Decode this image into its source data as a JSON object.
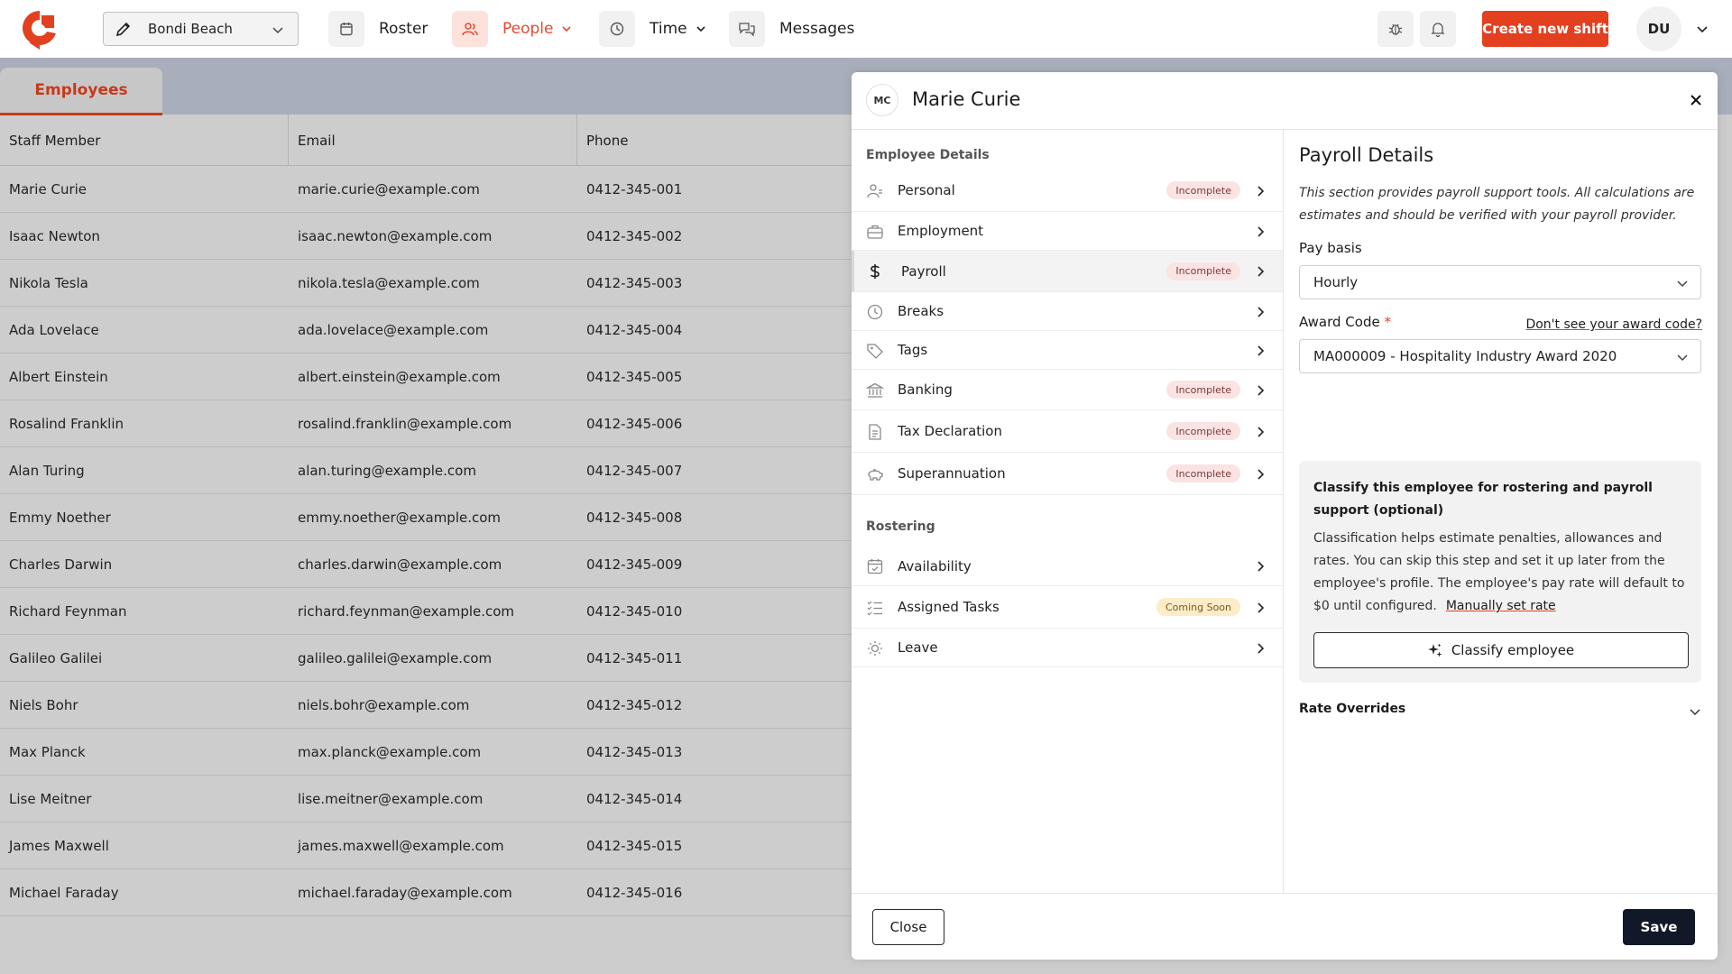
{
  "topbar": {
    "location": "Bondi Beach",
    "nav": [
      {
        "label": "Roster",
        "icon": "calendar-icon"
      },
      {
        "label": "People",
        "icon": "people-icon",
        "active": true
      },
      {
        "label": "Time",
        "icon": "clock-icon"
      },
      {
        "label": "Messages",
        "icon": "messages-icon"
      }
    ],
    "create_shift": "Create new shift",
    "user_initials": "DU",
    "accent_color": "#e2401f"
  },
  "tabs": {
    "employees": "Employees"
  },
  "table": {
    "headers": [
      "Staff Member",
      "Email",
      "Phone"
    ],
    "rows": [
      [
        "Marie Curie",
        "marie.curie@example.com",
        "0412-345-001"
      ],
      [
        "Isaac Newton",
        "isaac.newton@example.com",
        "0412-345-002"
      ],
      [
        "Nikola Tesla",
        "nikola.tesla@example.com",
        "0412-345-003"
      ],
      [
        "Ada Lovelace",
        "ada.lovelace@example.com",
        "0412-345-004"
      ],
      [
        "Albert Einstein",
        "albert.einstein@example.com",
        "0412-345-005"
      ],
      [
        "Rosalind Franklin",
        "rosalind.franklin@example.com",
        "0412-345-006"
      ],
      [
        "Alan Turing",
        "alan.turing@example.com",
        "0412-345-007"
      ],
      [
        "Emmy Noether",
        "emmy.noether@example.com",
        "0412-345-008"
      ],
      [
        "Charles Darwin",
        "charles.darwin@example.com",
        "0412-345-009"
      ],
      [
        "Richard Feynman",
        "richard.feynman@example.com",
        "0412-345-010"
      ],
      [
        "Galileo Galilei",
        "galileo.galilei@example.com",
        "0412-345-011"
      ],
      [
        "Niels Bohr",
        "niels.bohr@example.com",
        "0412-345-012"
      ],
      [
        "Max Planck",
        "max.planck@example.com",
        "0412-345-013"
      ],
      [
        "Lise Meitner",
        "lise.meitner@example.com",
        "0412-345-014"
      ],
      [
        "James Maxwell",
        "james.maxwell@example.com",
        "0412-345-015"
      ],
      [
        "Michael Faraday",
        "michael.faraday@example.com",
        "0412-345-016"
      ]
    ]
  },
  "modal": {
    "initials": "MC",
    "name": "Marie Curie",
    "section_employee": "Employee Details",
    "section_rostering": "Rostering",
    "employee_items": [
      {
        "label": "Personal",
        "badge": "Incomplete",
        "icon": "person-icon"
      },
      {
        "label": "Employment",
        "badge": "",
        "icon": "briefcase-icon"
      },
      {
        "label": "Payroll",
        "badge": "Incomplete",
        "icon": "dollar-icon"
      },
      {
        "label": "Breaks",
        "badge": "",
        "icon": "clock-icon"
      },
      {
        "label": "Tags",
        "badge": "",
        "icon": "tag-icon"
      },
      {
        "label": "Banking",
        "badge": "Incomplete",
        "icon": "bank-icon"
      },
      {
        "label": "Tax Declaration",
        "badge": "Incomplete",
        "icon": "document-icon"
      },
      {
        "label": "Superannuation",
        "badge": "Incomplete",
        "icon": "piggy-bank-icon"
      }
    ],
    "rostering_items": [
      {
        "label": "Availability",
        "badge": "",
        "icon": "calendar-check-icon"
      },
      {
        "label": "Assigned Tasks",
        "badge": "Coming Soon",
        "icon": "checklist-icon"
      },
      {
        "label": "Leave",
        "badge": "",
        "icon": "sun-icon"
      }
    ],
    "payroll": {
      "title": "Payroll Details",
      "description": "This section provides payroll support tools. All calculations are estimates and should be verified with your payroll provider.",
      "pay_basis_label": "Pay basis",
      "pay_basis_value": "Hourly",
      "award_label": "Award Code",
      "award_required": "*",
      "award_link": "Don't see your award code?",
      "award_value": "MA000009 - Hospitality Industry Award 2020",
      "classify_title": "Classify this employee for rostering and payroll support (optional)",
      "classify_text": "Classification helps estimate penalties, allowances and rates. You can skip this step and set it up later from the employee's profile. The employee's pay rate will default to $0 until configured.",
      "classify_link": "Manually set rate",
      "classify_button": "Classify employee",
      "rate_overrides": "Rate Overrides"
    },
    "footer": {
      "close": "Close",
      "save": "Save"
    }
  }
}
